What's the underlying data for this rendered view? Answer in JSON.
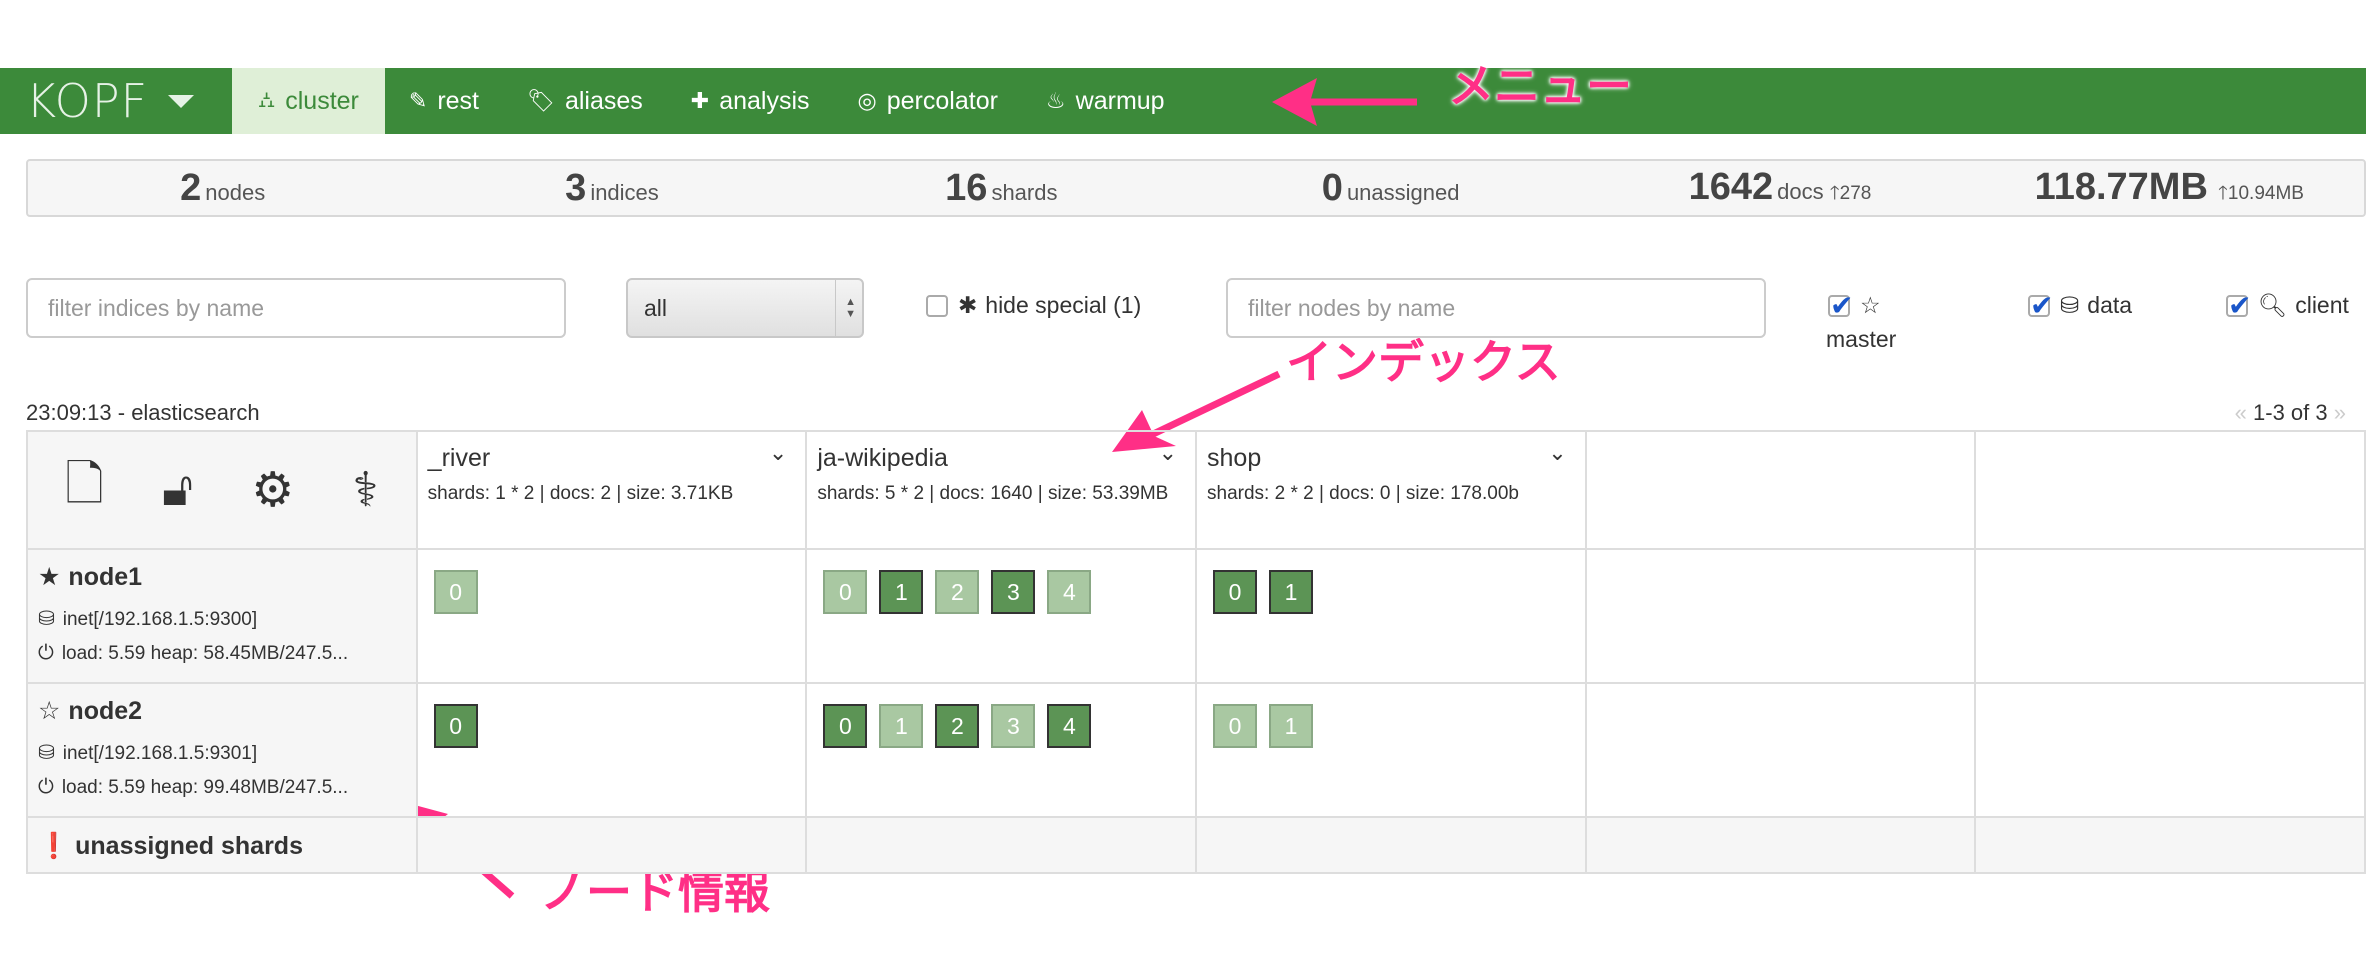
{
  "nav": {
    "brand": "KOPF",
    "items": [
      {
        "label": "cluster",
        "icon": "sitemap-icon",
        "glyph": "⛼",
        "active": true
      },
      {
        "label": "rest",
        "icon": "edit-icon",
        "glyph": "✎",
        "active": false
      },
      {
        "label": "aliases",
        "icon": "tags-icon",
        "glyph": "🏷",
        "active": false
      },
      {
        "label": "analysis",
        "icon": "puzzle-icon",
        "glyph": "✚",
        "active": false
      },
      {
        "label": "percolator",
        "icon": "target-icon",
        "glyph": "◎",
        "active": false
      },
      {
        "label": "warmup",
        "icon": "fire-icon",
        "glyph": "♨",
        "active": false
      }
    ]
  },
  "annotations": {
    "menu": "メニュー",
    "index": "インデックス",
    "node_info": "ノード情報"
  },
  "stats": {
    "nodes": {
      "value": "2",
      "label": "nodes"
    },
    "indices": {
      "value": "3",
      "label": "indices"
    },
    "shards": {
      "value": "16",
      "label": "shards"
    },
    "unassigned": {
      "value": "0",
      "label": "unassigned"
    },
    "docs": {
      "value": "1642",
      "label": "docs",
      "delta": "278"
    },
    "size": {
      "value": "118.77MB",
      "delta": "10.94MB"
    }
  },
  "filters": {
    "indices_placeholder": "filter indices by name",
    "select_value": "all",
    "hide_special_label": "hide special (1)",
    "nodes_placeholder": "filter nodes by name",
    "master_label": "master",
    "data_label": "data",
    "client_label": "client"
  },
  "caption": "23:09:13 - elasticsearch",
  "pager": "1-3 of 3",
  "indices": [
    {
      "name": "_river",
      "meta": "shards: 1 * 2 | docs: 2 | size: 3.71KB"
    },
    {
      "name": "ja-wikipedia",
      "meta": "shards: 5 * 2 | docs: 1640 | size: 53.39MB"
    },
    {
      "name": "shop",
      "meta": "shards: 2 * 2 | docs: 0 | size: 178.00b"
    }
  ],
  "nodes": [
    {
      "name": "node1",
      "master": true,
      "address": "inet[/192.168.1.5:9300]",
      "load": "load: 5.59  heap: 58.45MB/247.5...",
      "shards": [
        [
          {
            "n": "0",
            "primary": false
          }
        ],
        [
          {
            "n": "0",
            "primary": false
          },
          {
            "n": "1",
            "primary": true
          },
          {
            "n": "2",
            "primary": false
          },
          {
            "n": "3",
            "primary": true
          },
          {
            "n": "4",
            "primary": false
          }
        ],
        [
          {
            "n": "0",
            "primary": true
          },
          {
            "n": "1",
            "primary": true
          }
        ]
      ]
    },
    {
      "name": "node2",
      "master": false,
      "address": "inet[/192.168.1.5:9301]",
      "load": "load: 5.59  heap: 99.48MB/247.5...",
      "shards": [
        [
          {
            "n": "0",
            "primary": true
          }
        ],
        [
          {
            "n": "0",
            "primary": true
          },
          {
            "n": "1",
            "primary": false
          },
          {
            "n": "2",
            "primary": true
          },
          {
            "n": "3",
            "primary": false
          },
          {
            "n": "4",
            "primary": true
          }
        ],
        [
          {
            "n": "0",
            "primary": false
          },
          {
            "n": "1",
            "primary": false
          }
        ]
      ]
    }
  ],
  "unassigned_label": "unassigned shards",
  "colors": {
    "navbar": "#3c8a3a",
    "primary_shard": "#5c9455",
    "replica_shard": "#a9c8a2",
    "annotation": "#ff2f86"
  }
}
